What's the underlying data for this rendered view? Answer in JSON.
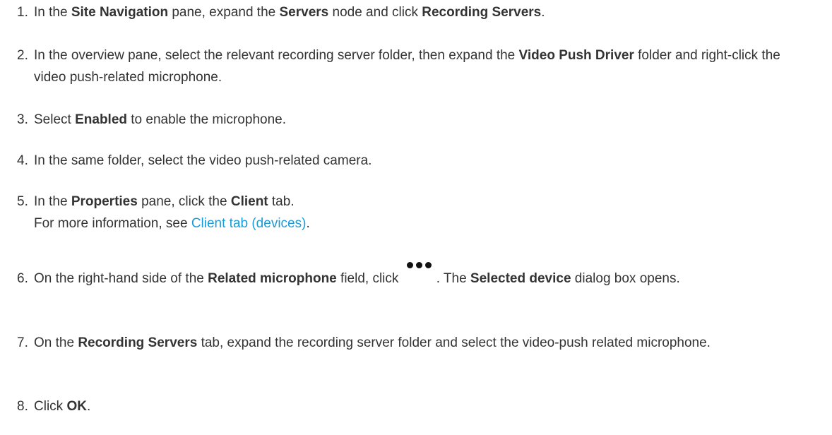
{
  "steps": [
    {
      "num": "1.",
      "t1": "In the ",
      "b1": "Site Navigation",
      "t2": " pane, expand the ",
      "b2": "Servers",
      "t3": " node and click ",
      "b3": "Recording Servers",
      "t4": "."
    },
    {
      "num": "2.",
      "t1": "In the overview pane, select the relevant recording server folder, then expand the ",
      "b1": "Video Push Driver",
      "t2": " folder and right-click the video push-related microphone."
    },
    {
      "num": "3.",
      "t1": "Select ",
      "b1": "Enabled",
      "t2": " to enable the microphone."
    },
    {
      "num": "4.",
      "t1": "In the same folder, select the video push-related camera."
    },
    {
      "num": "5.",
      "t1": "In the ",
      "b1": "Properties",
      "t2": " pane, click the ",
      "b2": "Client",
      "t3": " tab.",
      "line2_text": "For more information, see ",
      "link": "Client tab (devices)",
      "line2_end": "."
    },
    {
      "num": "6.",
      "t1": "On the right-hand side of the ",
      "b1": "Related microphone",
      "t2": " field, click ",
      "icon": "ellipsis-icon",
      "t3": ". The ",
      "b2": "Selected device",
      "t4": " dialog box opens."
    },
    {
      "num": "7.",
      "t1": "On the ",
      "b1": "Recording Servers",
      "t2": " tab, expand the recording server folder and select the video-push related microphone."
    },
    {
      "num": "8.",
      "t1": "Click ",
      "b1": "OK",
      "t2": "."
    }
  ],
  "colors": {
    "text": "#333333",
    "link": "#1a9bd7"
  }
}
